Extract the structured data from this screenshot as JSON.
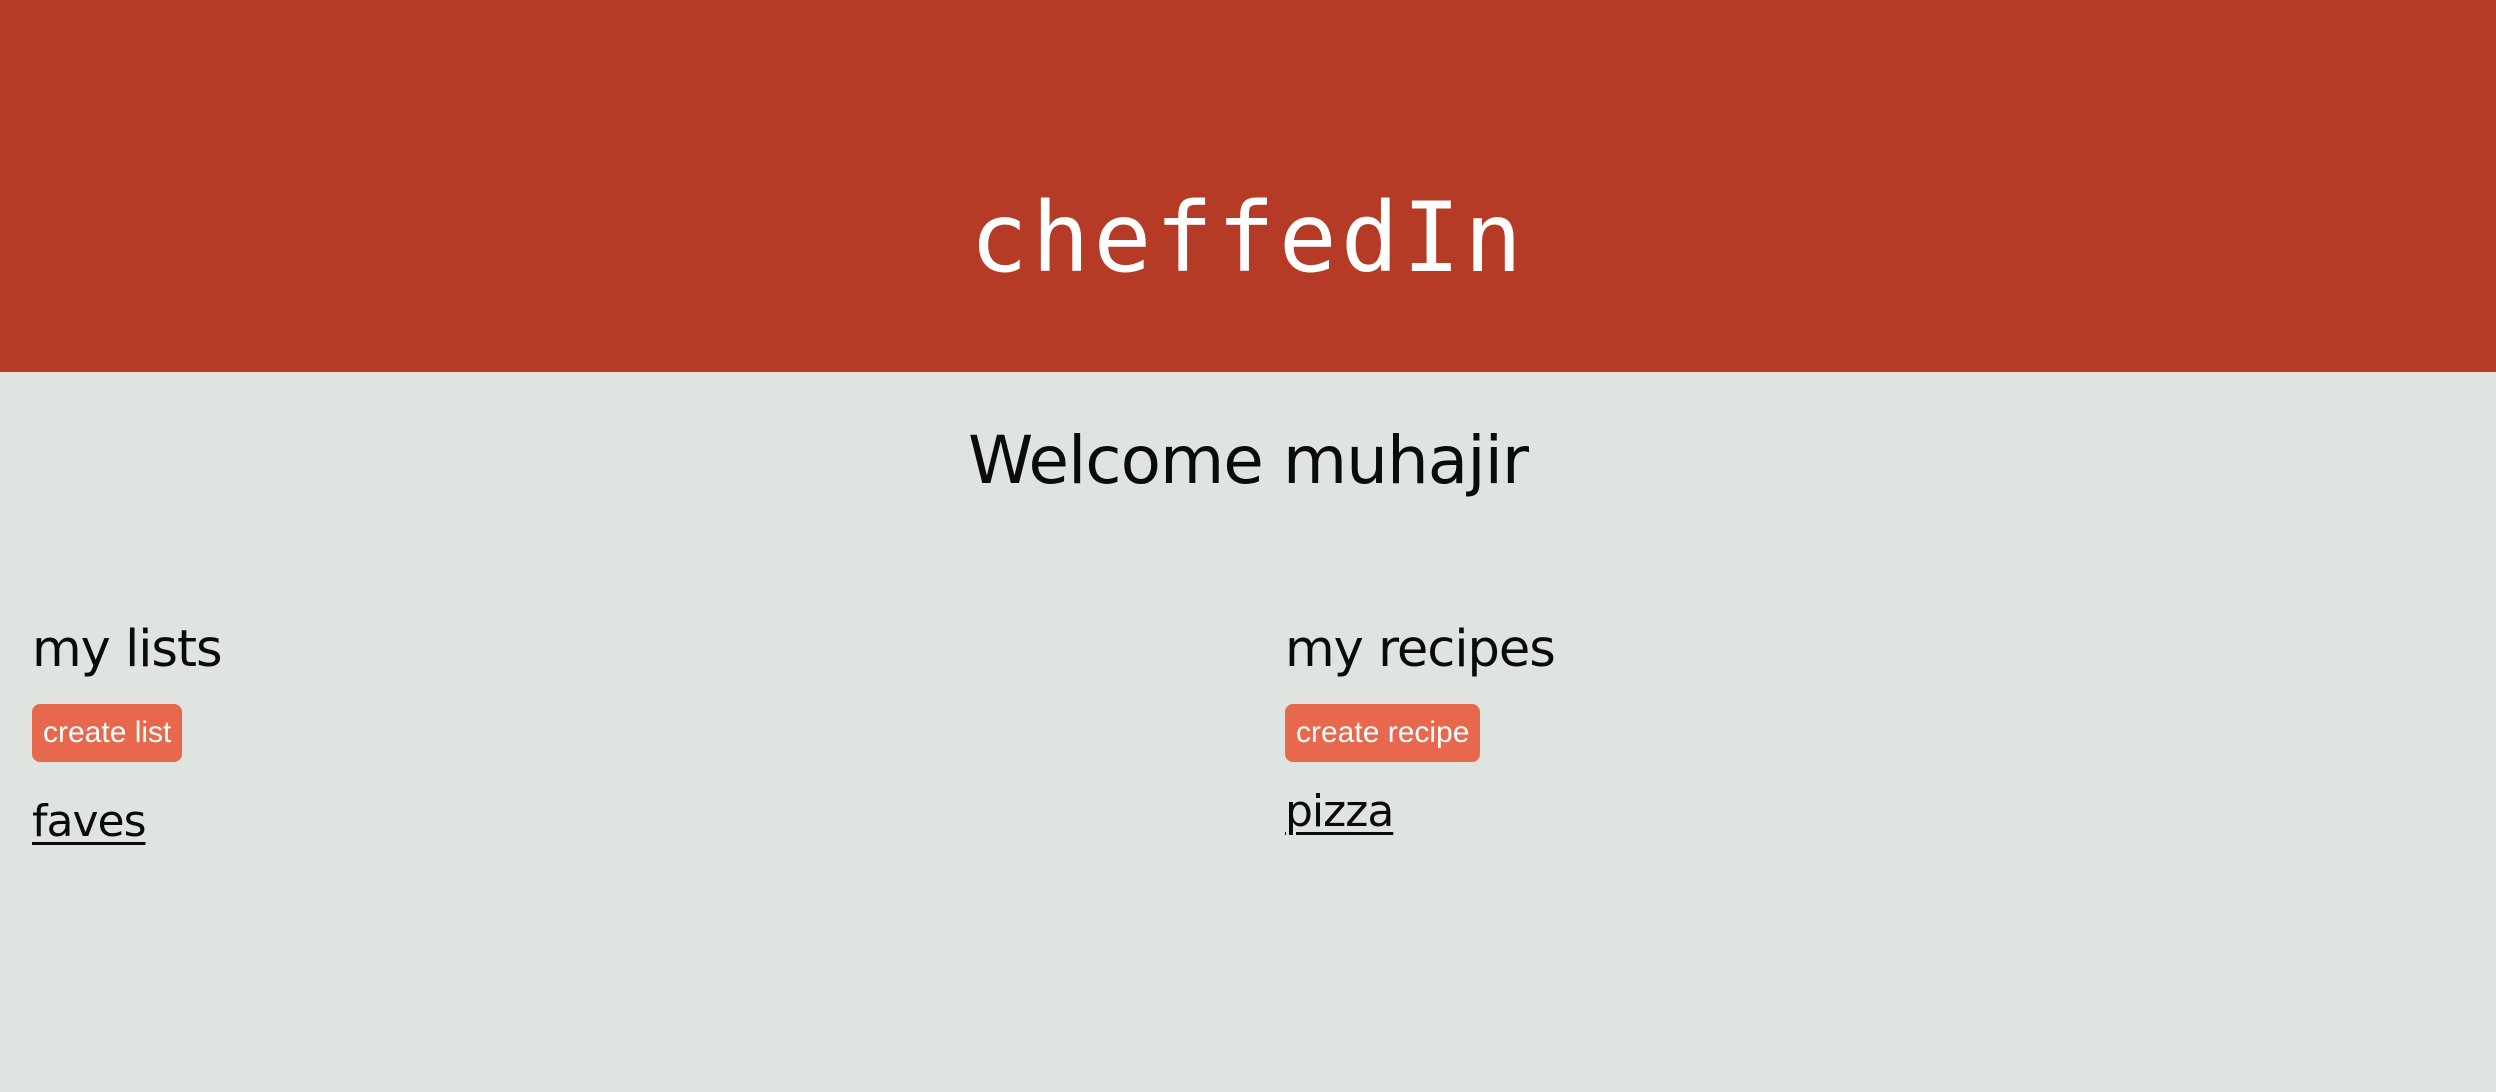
{
  "header": {
    "brand": "cheffedIn",
    "background_color": "#b53b27"
  },
  "welcome": "Welcome muhajir",
  "lists": {
    "heading": "my lists",
    "create_label": "create list",
    "items": [
      "faves"
    ]
  },
  "recipes": {
    "heading": "my recipes",
    "create_label": "create recipe",
    "items": [
      "pizza"
    ]
  },
  "colors": {
    "page_background": "#dfe4e0",
    "button": "#e8684d"
  }
}
